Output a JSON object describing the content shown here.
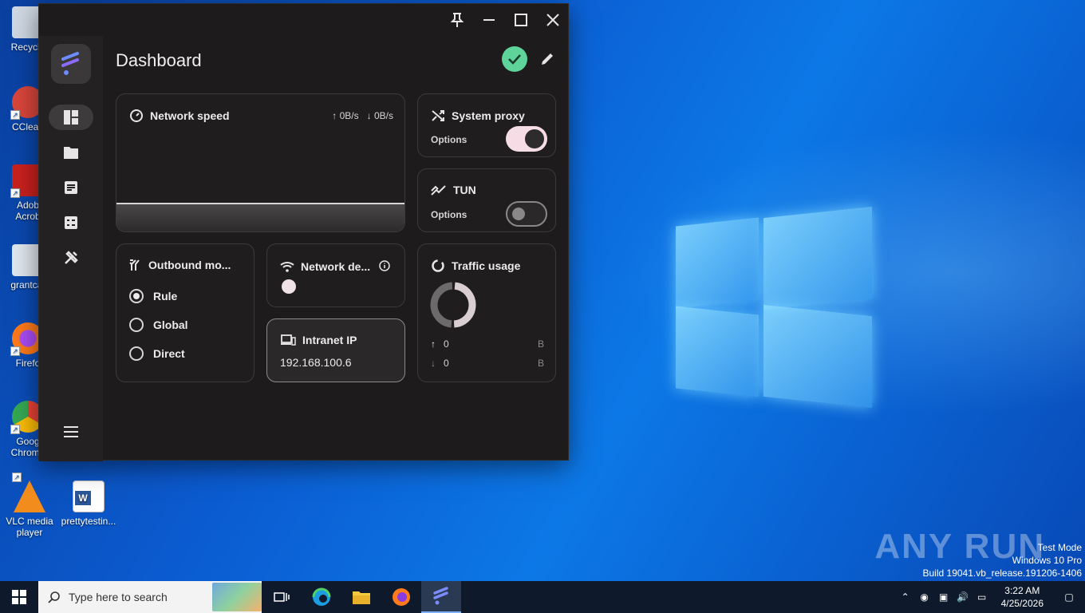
{
  "desktop": {
    "icons": [
      {
        "label": "Recycle",
        "color": "#cfd8e3"
      },
      {
        "label": "CClean",
        "color": "#d9463b"
      },
      {
        "label": "Adob Acrob",
        "color": "#c9211e"
      },
      {
        "label": "grantcat",
        "color": "#dfe6ee"
      },
      {
        "label": "Firefo",
        "color": "#ff7a1a"
      },
      {
        "label": "Goog Chrome",
        "color": "#34a853"
      },
      {
        "label": "VLC media player",
        "color": "#f28c1c"
      },
      {
        "label": "prettytestin...",
        "color": "#2b579a"
      }
    ],
    "watermark": "ANY RUN",
    "test_mode": [
      "Test Mode",
      "Windows 10 Pro",
      "Build 19041.vb_release.191206-1406"
    ]
  },
  "taskbar": {
    "search_placeholder": "Type here to search",
    "time": "3:22 AM",
    "date": "4/25/2026"
  },
  "app": {
    "title": "Dashboard",
    "accent": "#5ed39a",
    "network_speed": {
      "title": "Network speed",
      "up": "↑ 0B/s",
      "down": "↓ 0B/s"
    },
    "system_proxy": {
      "title": "System proxy",
      "options": "Options",
      "enabled": true
    },
    "tun": {
      "title": "TUN",
      "options": "Options",
      "enabled": false
    },
    "outbound_mode": {
      "title": "Outbound mo...",
      "options": [
        "Rule",
        "Global",
        "Direct"
      ],
      "selected": "Rule"
    },
    "network_detection": {
      "title": "Network de..."
    },
    "intranet_ip": {
      "title": "Intranet IP",
      "value": "192.168.100.6"
    },
    "traffic_usage": {
      "title": "Traffic usage",
      "up_value": "0",
      "up_unit": "B",
      "down_value": "0",
      "down_unit": "B"
    }
  }
}
